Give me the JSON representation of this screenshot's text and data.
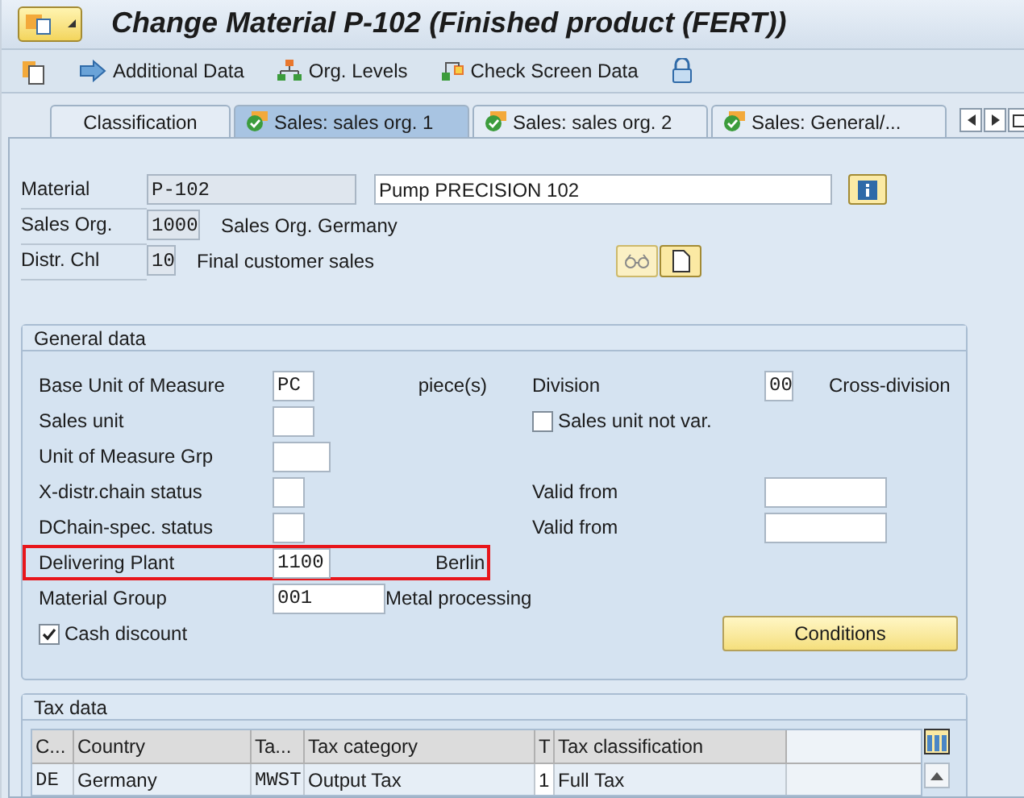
{
  "window": {
    "title": "Change Material P-102 (Finished product (FERT))"
  },
  "toolbar": [
    {
      "kind": "icon"
    },
    {
      "kind": "arrow",
      "label": "Additional Data"
    },
    {
      "kind": "tree",
      "label": "Org. Levels"
    },
    {
      "kind": "check",
      "label": "Check Screen Data"
    },
    {
      "kind": "lock"
    }
  ],
  "tabs": [
    {
      "label": "Classification",
      "kind": "plain",
      "selected": false
    },
    {
      "label": "Sales: sales org. 1",
      "kind": "checked",
      "selected": true
    },
    {
      "label": "Sales: sales org. 2",
      "kind": "checked",
      "selected": false
    },
    {
      "label": "Sales: General/...",
      "kind": "checked",
      "selected": false
    }
  ],
  "header": [
    {
      "label": "Material",
      "value": "P-102",
      "description": "Pump PRECISION 102",
      "kind": "field"
    },
    {
      "label": "Sales Org.",
      "value": "1000",
      "description": "Sales Org. Germany",
      "kind": "text"
    },
    {
      "label": "Distr. Chl",
      "value": "10",
      "description": "Final customer sales",
      "kind": "text"
    }
  ],
  "general_data": {
    "title": "General data",
    "rows": [
      {
        "kind": "field",
        "label": "Base Unit of Measure",
        "value": "PC",
        "description": "piece(s)",
        "highlighted": false,
        "right": {
          "kind": "field",
          "label": "Division",
          "value": "00",
          "description": "Cross-division"
        }
      },
      {
        "kind": "field",
        "label": "Sales unit",
        "highlighted": false,
        "right": {
          "kind": "checkbox",
          "label": "Sales unit not var.",
          "checked": false
        }
      },
      {
        "kind": "field",
        "label": "Unit of Measure Grp",
        "highlighted": false
      },
      {
        "kind": "field",
        "label": "X-distr.chain status",
        "highlighted": false,
        "right": {
          "kind": "field",
          "label": "Valid from"
        }
      },
      {
        "kind": "field",
        "label": "DChain-spec. status",
        "highlighted": false,
        "right": {
          "kind": "field",
          "label": "Valid from"
        }
      },
      {
        "kind": "field",
        "label": "Delivering Plant",
        "value": "1100",
        "description": "Berlin",
        "highlighted": true
      },
      {
        "kind": "field",
        "label": "Material Group",
        "value": "001",
        "description": "Metal processing",
        "highlighted": false
      },
      {
        "kind": "checkbox",
        "label": "Cash discount",
        "checked": true,
        "highlighted": false,
        "right": {
          "kind": "button",
          "label": "Conditions"
        }
      }
    ]
  },
  "tax_data": {
    "title": "Tax data",
    "columns": [
      "C...",
      "Country",
      "Ta...",
      "Tax category",
      "T",
      "Tax classification"
    ],
    "rows": [
      [
        "DE",
        "Germany",
        "MWST",
        "Output Tax",
        "1",
        "Full Tax"
      ]
    ]
  }
}
